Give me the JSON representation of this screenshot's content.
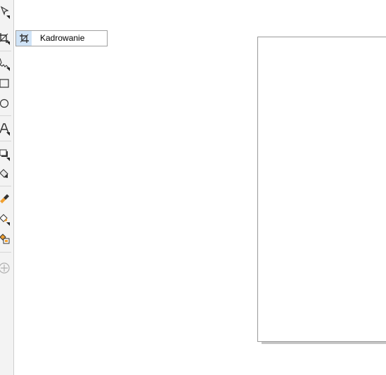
{
  "tooltip": {
    "label": "Kadrowanie"
  },
  "toolbox": {
    "tools": [
      {
        "name": "shape-tool",
        "icon": "shape-edit-icon"
      },
      {
        "name": "crop-tool",
        "icon": "crop-icon",
        "active": true
      },
      {
        "name": "freehand-tool",
        "icon": "freehand-icon"
      },
      {
        "name": "rectangle-tool",
        "icon": "rectangle-icon"
      },
      {
        "name": "ellipse-tool",
        "icon": "ellipse-icon"
      },
      {
        "name": "text-tool",
        "icon": "text-icon"
      },
      {
        "name": "drop-shadow-tool",
        "icon": "drop-shadow-icon"
      },
      {
        "name": "transparency-tool",
        "icon": "transparency-icon"
      },
      {
        "name": "color-eyedropper-tool",
        "icon": "eyedropper-icon"
      },
      {
        "name": "interactive-fill-tool",
        "icon": "fill-bucket-icon"
      },
      {
        "name": "smart-fill-tool",
        "icon": "smart-fill-icon"
      },
      {
        "name": "add-tool",
        "icon": "plus-circle-icon"
      }
    ]
  },
  "colors": {
    "accent": "#cfe3f7",
    "icon_dark": "#333333",
    "icon_orange": "#f0a030",
    "page_border": "#9a9a9a"
  }
}
